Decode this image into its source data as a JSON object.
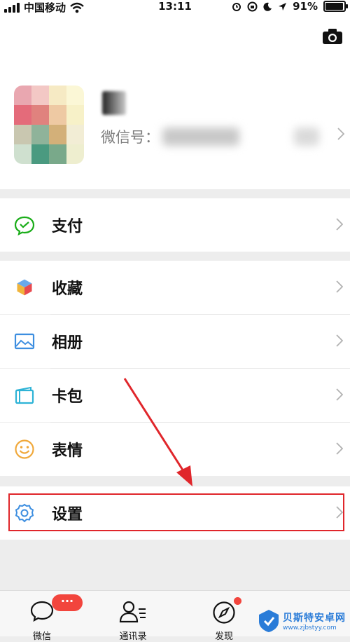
{
  "status_bar": {
    "carrier": "中国移动",
    "time": "13:11",
    "battery_text": "91%",
    "battery_level": 0.91
  },
  "profile": {
    "wechat_id_label": "微信号："
  },
  "menu": {
    "pay": "支付",
    "favorites": "收藏",
    "album": "相册",
    "cards": "卡包",
    "stickers": "表情",
    "settings": "设置"
  },
  "tabbar": {
    "chats": "微信",
    "contacts": "通讯录",
    "discover": "发现",
    "chats_badge": "···"
  },
  "watermark": {
    "name": "贝斯特安卓网",
    "url": "www.zjbstyy.com"
  },
  "colors": {
    "highlight": "#e0262b",
    "badge": "#f2453d",
    "pay_green": "#1aad19",
    "divider": "#e6e6e6"
  },
  "icons": [
    "wifi-icon",
    "alarm-icon",
    "location-icon",
    "camera-icon",
    "pay-icon",
    "favorites-icon",
    "album-icon",
    "cards-icon",
    "stickers-icon",
    "settings-gear-icon",
    "chevron-right-icon",
    "chat-bubble-icon",
    "contacts-icon",
    "compass-icon"
  ]
}
